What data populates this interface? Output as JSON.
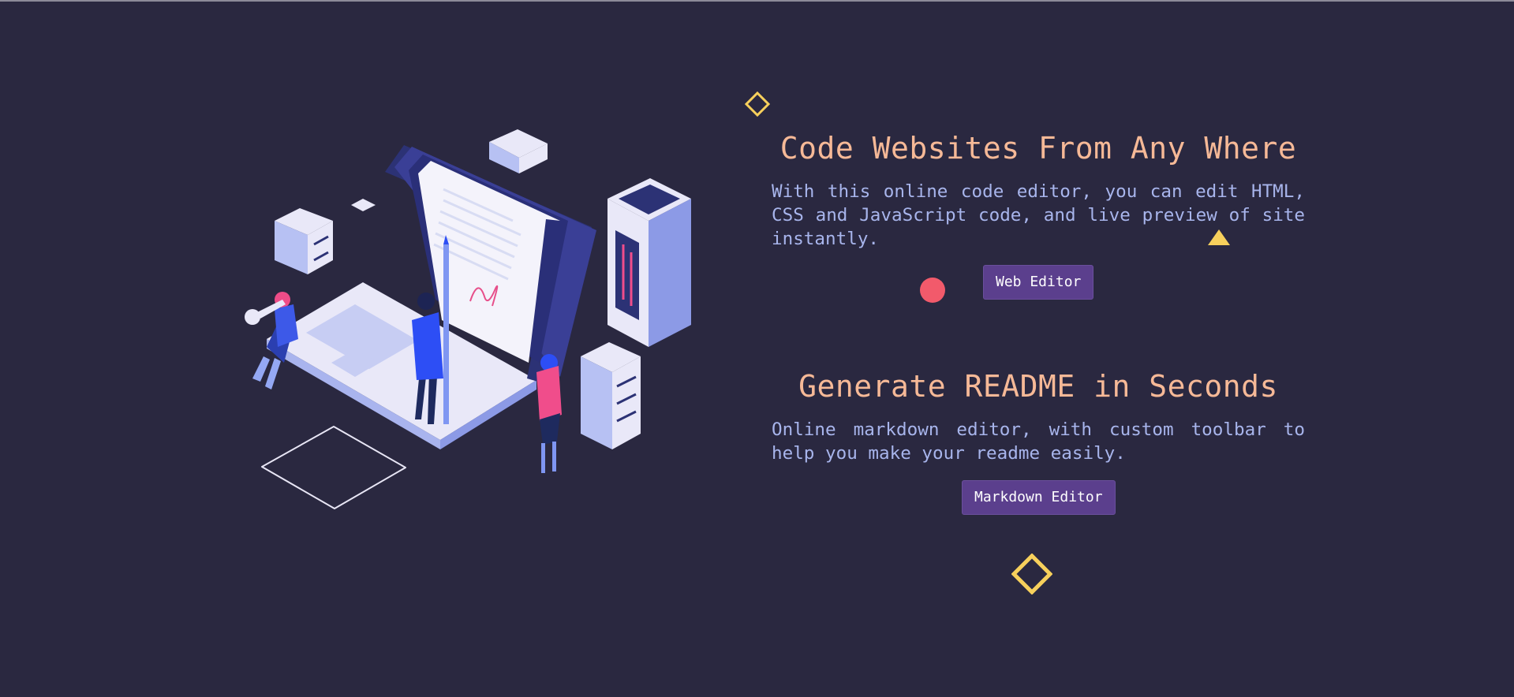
{
  "colors": {
    "background": "#2a2840",
    "title": "#f6b997",
    "text": "#a8b5ec",
    "button": "#5b3f8d",
    "accent_yellow": "#f7d05c",
    "accent_red": "#f25a6b"
  },
  "sections": [
    {
      "title": "Code Websites From Any Where",
      "description": "With this online code editor, you can edit HTML, CSS and JavaScript code, and live preview of site instantly.",
      "button_label": "Web Editor"
    },
    {
      "title": "Generate README in Seconds",
      "description": "Online markdown editor, with custom toolbar to help you make your readme easily.",
      "button_label": "Markdown Editor"
    }
  ],
  "decorations": [
    "diamond-outline-icon",
    "triangle-icon",
    "circle-dot-icon",
    "diamond-outline-icon"
  ],
  "illustration": {
    "subject": "isometric laptop with people and servers",
    "icons": [
      "laptop-icon",
      "server-icon",
      "key-icon",
      "person-icon",
      "document-icon"
    ]
  }
}
